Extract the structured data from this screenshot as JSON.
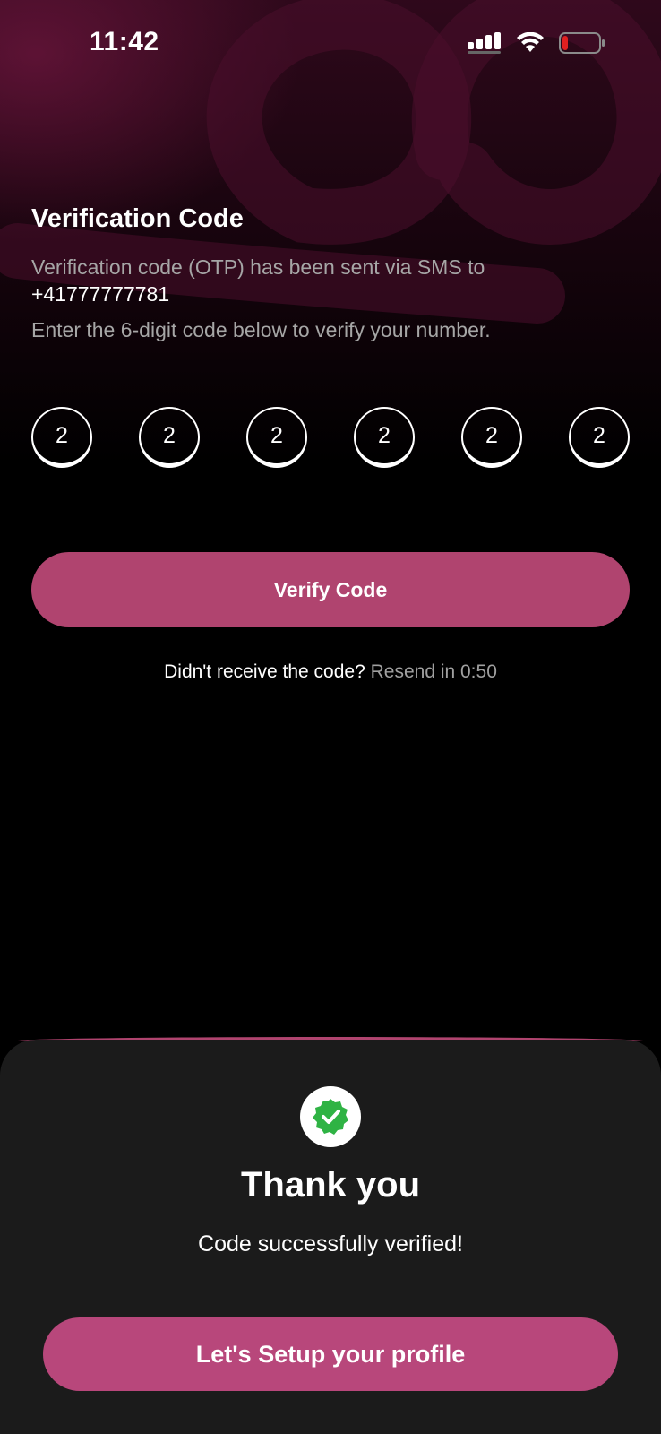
{
  "status_bar": {
    "time": "11:42",
    "icons": [
      "cellular-signal-icon",
      "wifi-icon",
      "battery-low-icon"
    ]
  },
  "verification": {
    "title": "Verification Code",
    "sent_message": "Verification code (OTP) has been sent via SMS to",
    "phone_number": "+41777777781",
    "instruction": "Enter the 6-digit code below to verify your number.",
    "otp_digits": [
      "2",
      "2",
      "2",
      "2",
      "2",
      "2"
    ],
    "verify_button_label": "Verify Code",
    "resend_question": "Didn't receive the code?",
    "resend_timer": "Resend in 0:50"
  },
  "success_sheet": {
    "icon": "verified-check-icon",
    "title": "Thank you",
    "message": "Code successfully verified!",
    "setup_button_label": "Let's Setup your profile"
  },
  "colors": {
    "accent": "#b0446f",
    "background": "#000000",
    "sheet_background": "#1b1b1b",
    "success_green": "#2fb344"
  }
}
